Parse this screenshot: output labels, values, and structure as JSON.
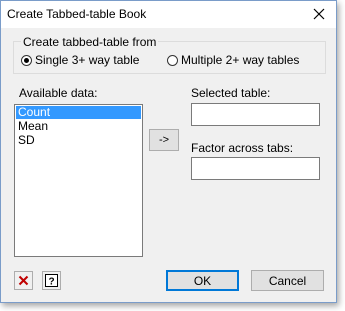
{
  "window": {
    "title": "Create Tabbed-table Book",
    "close_icon": "close-icon"
  },
  "group": {
    "label": "Create tabbed-table from",
    "options": [
      {
        "label": "Single 3+ way table",
        "checked": true
      },
      {
        "label": "Multiple 2+ way tables",
        "checked": false
      }
    ]
  },
  "available": {
    "label": "Available data:",
    "items": [
      {
        "label": "Count",
        "selected": true
      },
      {
        "label": "Mean",
        "selected": false
      },
      {
        "label": "SD",
        "selected": false
      }
    ]
  },
  "transfer_button": {
    "label": "->"
  },
  "selected_table": {
    "label": "Selected table:",
    "value": ""
  },
  "factor_across_tabs": {
    "label": "Factor across tabs:",
    "value": ""
  },
  "footer": {
    "clear_icon": "clear-icon",
    "help_icon": "help-icon",
    "ok_label": "OK",
    "cancel_label": "Cancel"
  },
  "colors": {
    "selection": "#3399ff",
    "clear_icon": "#c00000",
    "default_button_border": "#0078d7"
  }
}
